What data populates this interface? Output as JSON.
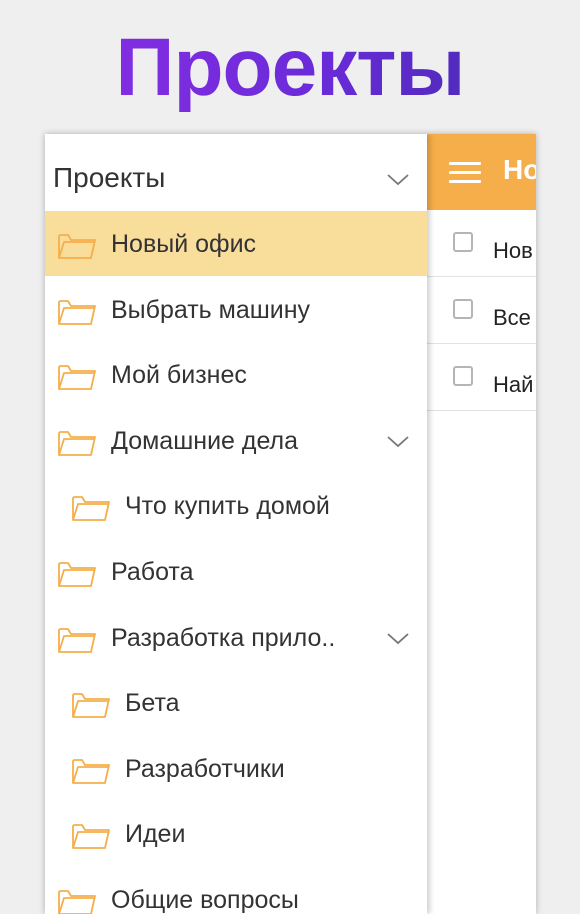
{
  "banner": {
    "title": "Проекты"
  },
  "app": {
    "toolbar_title": "Но",
    "accent_color": "#f5ae4a",
    "selected_color": "#f9de9b",
    "tasks": [
      {
        "title": "Нов",
        "checked": false
      },
      {
        "title": "Все",
        "checked": false
      },
      {
        "title": "Най",
        "checked": false
      }
    ]
  },
  "drawer": {
    "header_title": "Проекты",
    "header_icon": "chevron-down-icon",
    "items": [
      {
        "label": "Новый офис",
        "level": 0,
        "selected": true,
        "expandable": false,
        "icon": "folder-icon"
      },
      {
        "label": "Выбрать машину",
        "level": 0,
        "selected": false,
        "expandable": false,
        "icon": "folder-icon"
      },
      {
        "label": "Мой бизнес",
        "level": 0,
        "selected": false,
        "expandable": false,
        "icon": "folder-icon"
      },
      {
        "label": "Домашние дела",
        "level": 0,
        "selected": false,
        "expandable": true,
        "icon": "folder-icon"
      },
      {
        "label": "Что купить домой",
        "level": 1,
        "selected": false,
        "expandable": false,
        "icon": "folder-icon"
      },
      {
        "label": "Работа",
        "level": 0,
        "selected": false,
        "expandable": false,
        "icon": "folder-icon"
      },
      {
        "label": "Разработка прило..",
        "level": 0,
        "selected": false,
        "expandable": true,
        "icon": "folder-icon"
      },
      {
        "label": "Бета",
        "level": 1,
        "selected": false,
        "expandable": false,
        "icon": "folder-icon"
      },
      {
        "label": "Разработчики",
        "level": 1,
        "selected": false,
        "expandable": false,
        "icon": "folder-icon"
      },
      {
        "label": "Идеи",
        "level": 1,
        "selected": false,
        "expandable": false,
        "icon": "folder-icon"
      },
      {
        "label": "Общие вопросы",
        "level": 0,
        "selected": false,
        "expandable": false,
        "icon": "folder-icon"
      }
    ]
  }
}
